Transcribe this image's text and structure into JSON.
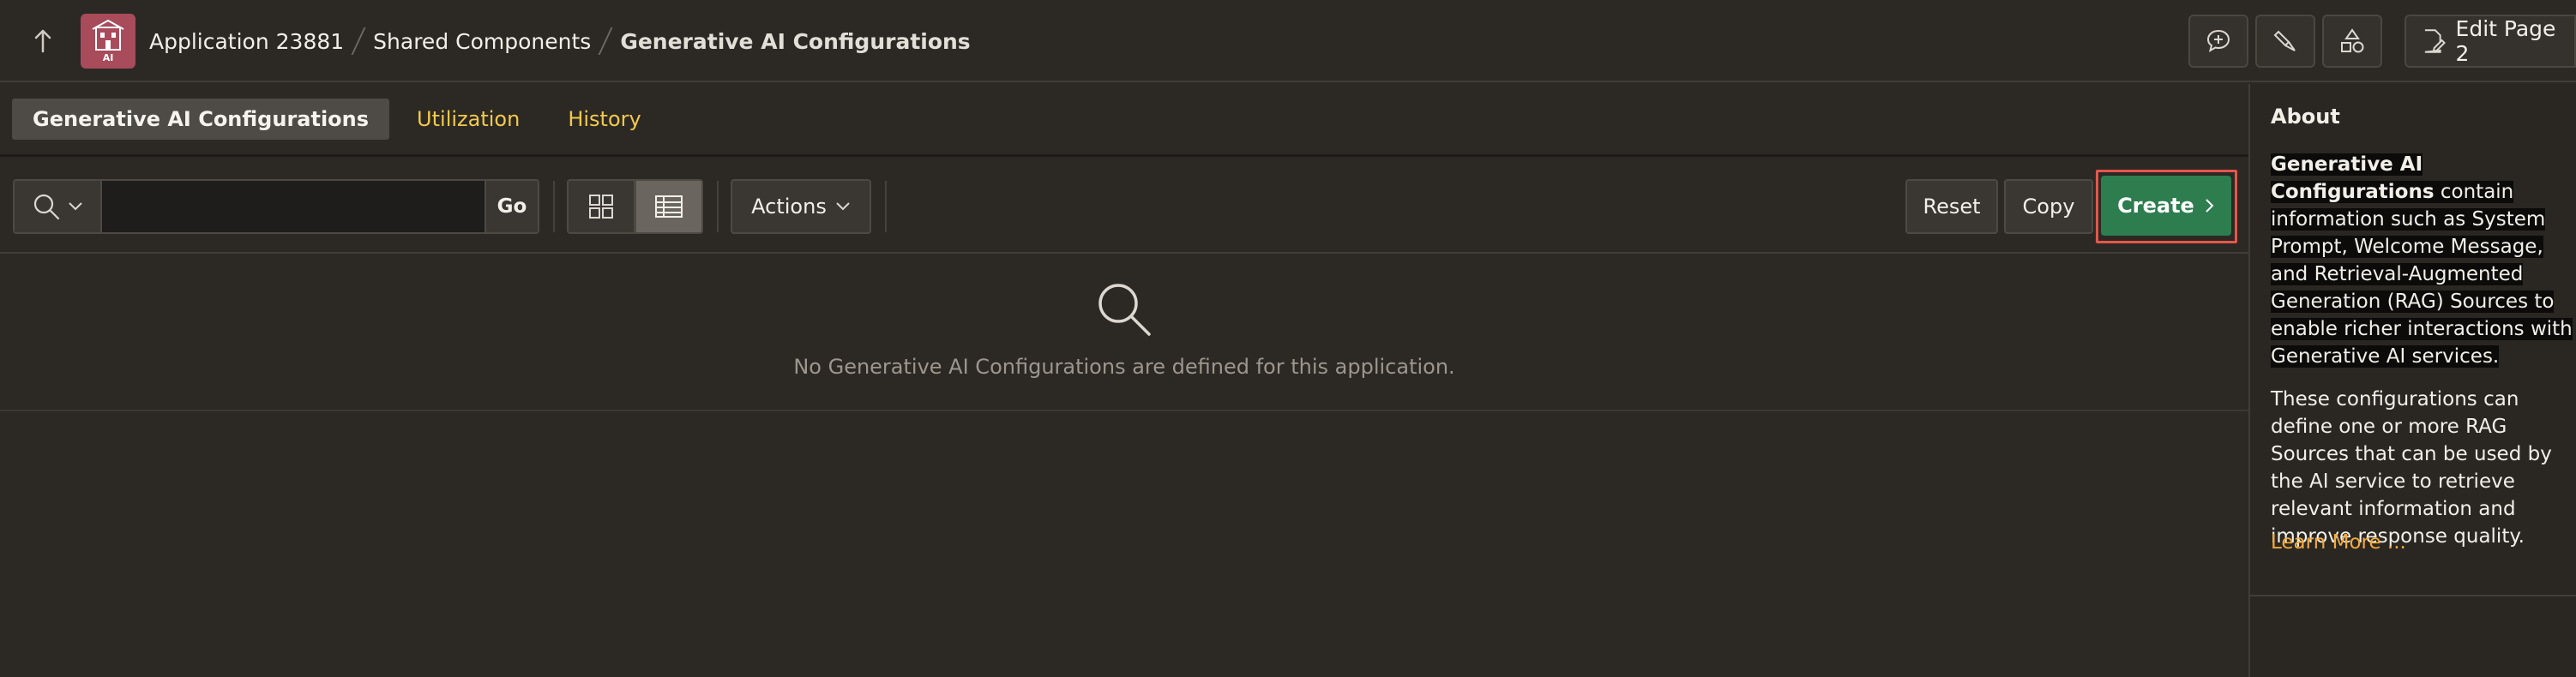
{
  "header": {
    "app_badge_text": "AI",
    "breadcrumbs": [
      {
        "label": "Application 23881"
      },
      {
        "label": "Shared Components"
      },
      {
        "label": "Generative AI Configurations"
      }
    ],
    "edit_page_label": "Edit Page 2",
    "icons": [
      "up-arrow-icon",
      "comment-add-icon",
      "brush-icon",
      "shapes-icon",
      "edit-page-icon"
    ]
  },
  "tabs": [
    {
      "label": "Generative AI Configurations",
      "active": true
    },
    {
      "label": "Utilization",
      "active": false
    },
    {
      "label": "History",
      "active": false
    }
  ],
  "toolbar": {
    "search_value": "",
    "go_label": "Go",
    "actions_label": "Actions",
    "reset_label": "Reset",
    "copy_label": "Copy",
    "create_label": "Create",
    "highlight_color": "#e4574b",
    "create_color": "#2e7d4f"
  },
  "empty_state": {
    "message": "No Generative AI Configurations are defined for this application."
  },
  "sidebar": {
    "title": "About",
    "para1_bold": "Generative AI Configurations",
    "para1_rest": "contain information such as System Prompt, Welcome Message, and Retrieval-Augmented Generation (RAG) Sources to enable richer interactions with Generative AI services.",
    "para2": "These configurations can define one or more RAG Sources that can be used by the AI service to retrieve relevant information and improve response quality.",
    "learn_more": "Learn More ..."
  }
}
